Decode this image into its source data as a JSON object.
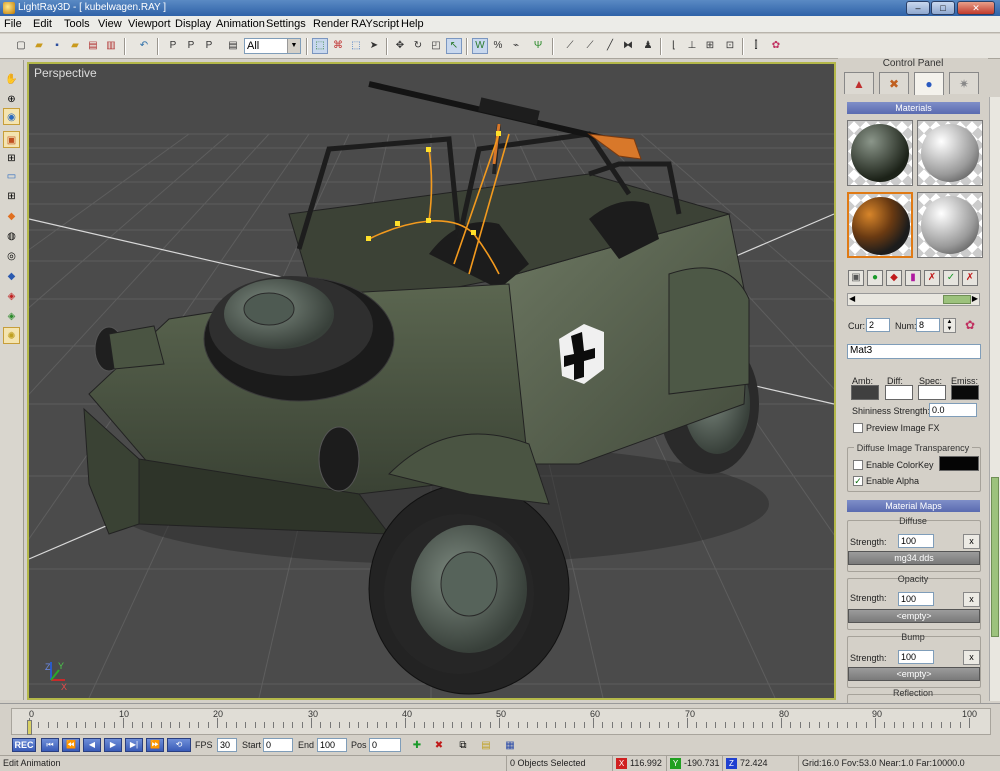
{
  "window": {
    "title": "LightRay3D - [ kubelwagen.RAY ]",
    "buttons": {
      "minimize": "–",
      "maximize": "□",
      "close": "✕"
    }
  },
  "menu": [
    "File",
    "Edit",
    "Tools",
    "View",
    "Viewport",
    "Display",
    "Animation",
    "Settings",
    "Render",
    "RAYscript",
    "Help"
  ],
  "toolbar": {
    "select_filter": "All",
    "icons": [
      "new-icon",
      "open-icon",
      "save-icon",
      "open-folder-icon",
      "print-icon",
      "export-icon",
      "undo-icon",
      "select-point-icon",
      "select-poly-icon",
      "select-face-icon",
      "filter-icon",
      "region-select-icon",
      "lasso-icon",
      "arrow-select-icon",
      "move-icon",
      "rotate-icon",
      "scale-icon",
      "pick-icon",
      "weld-icon",
      "split-icon",
      "pin-icon",
      "knife-icon",
      "pen-icon",
      "mirror-icon",
      "group-icon",
      "align-icon",
      "snap-icon",
      "grid-icon",
      "material-editor-icon",
      "palette-icon"
    ]
  },
  "left_tools": [
    "hand-icon",
    "camera-icon",
    "eye-icon",
    "select-box-icon",
    "grid-icon",
    "monitor-icon",
    "grid-large-icon",
    "eraser-icon",
    "sphere-icon",
    "cube-icon",
    "cylinder-icon",
    "color-cube-icon",
    "layer-cube-icon",
    "light-bulb-icon"
  ],
  "viewport": {
    "label": "Perspective",
    "axes": {
      "x": "X",
      "y": "Y",
      "z": "Z"
    }
  },
  "control_panel": {
    "title": "Control Panel",
    "tabs": [
      "geometry-tab-icon",
      "tools-tab-icon",
      "materials-tab-icon",
      "render-tab-icon"
    ],
    "materials_header": "Materials",
    "cur_label": "Cur:",
    "cur_value": "2",
    "num_label": "Num:",
    "num_value": "8",
    "material_name": "Mat3",
    "color_labels": {
      "amb": "Amb:",
      "diff": "Diff:",
      "spec": "Spec:",
      "emiss": "Emiss:"
    },
    "colors": {
      "amb": "#404040",
      "diff": "#ffffff",
      "spec": "#ffffff",
      "emiss": "#0a0a0a",
      "colorkey": "#050505"
    },
    "shininess_label": "Shininess Strength:",
    "shininess_value": "0.0",
    "preview_fx": "Preview Image FX",
    "diffuse_transparency": "Diffuse Image Transparency",
    "enable_colorkey": "Enable ColorKey",
    "enable_alpha": "Enable Alpha",
    "alpha_checked": "✓",
    "material_maps_header": "Material Maps",
    "maps": [
      {
        "title": "Diffuse",
        "strength_label": "Strength:",
        "strength": "100",
        "file": "mg34.dds",
        "clear": "x"
      },
      {
        "title": "Opacity",
        "strength_label": "Strength:",
        "strength": "100",
        "file": "<empty>",
        "clear": "x"
      },
      {
        "title": "Bump",
        "strength_label": "Strength:",
        "strength": "100",
        "file": "<empty>",
        "clear": "x"
      }
    ],
    "reflection_title": "Reflection"
  },
  "timeline": {
    "labels": [
      "0",
      "10",
      "20",
      "30",
      "40",
      "50",
      "60",
      "70",
      "80",
      "90",
      "100"
    ],
    "rec": "REC",
    "fps_label": "FPS",
    "fps": "30",
    "start_label": "Start",
    "start": "0",
    "end_label": "End",
    "end": "100",
    "pos_label": "Pos",
    "pos": "0"
  },
  "status": {
    "mode": "Edit Animation",
    "objects": "0 Objects Selected",
    "x": "116.992",
    "y": "-190.731",
    "z": "72.424",
    "grid": "Grid:16.0 Fov:53.0 Near:1.0 Far:10000.0"
  }
}
